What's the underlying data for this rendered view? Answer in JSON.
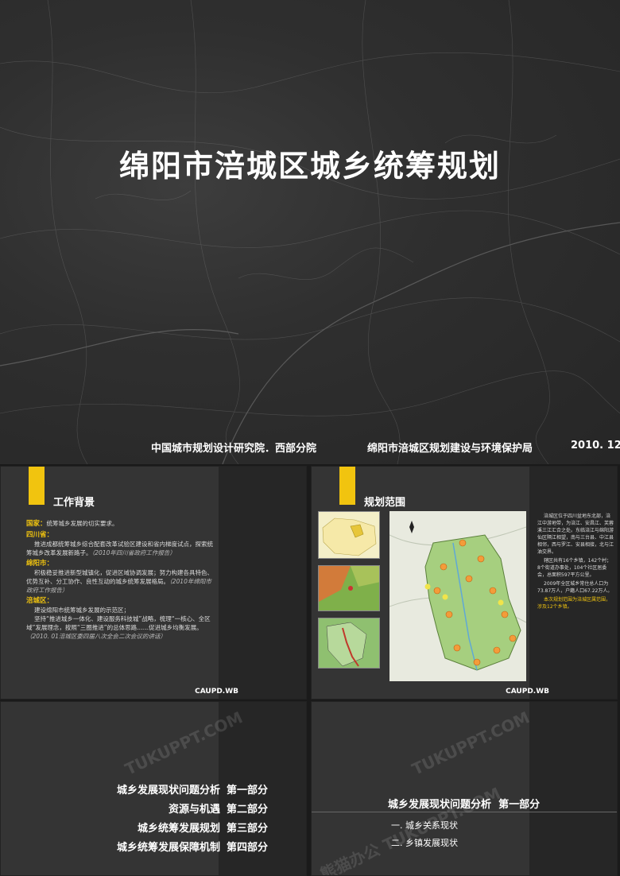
{
  "cover": {
    "title": "绵阳市涪城区城乡统筹规划",
    "org1": "中国城市规划设计研究院．西部分院",
    "org2": "绵阳市涪城区规划建设与环境保护局",
    "date": "2010. 12"
  },
  "slide1": {
    "title": "工作背景",
    "national_head": "国家：",
    "national_text": "统筹城乡发展的切实要求。",
    "sichuan_head": "四川省：",
    "sichuan_text": "推进成都统筹城乡综合配套改革试验区建设和省内梯度试点，探索统筹城乡改革发展新路子。",
    "sichuan_note": "（2010年四川省政府工作报告）",
    "mianyang_head": "绵阳市：",
    "mianyang_text": "积极稳妥推进新型城镇化，促进区域协调发展；努力构建各具特色、优势互补、分工协作、良性互动的城乡统筹发展格局。",
    "mianyang_note": "（2010年绵阳市政府工作报告）",
    "fucheng_head": "涪城区：",
    "fucheng_text1": "建设绵阳市统筹城乡发展的示范区；",
    "fucheng_text2": "坚持“推进城乡一体化、建设服务科技城”战略，梳理“一核心、全区域”发展理念，按照“三圈推进”的总体思路……促进城乡均衡发展。",
    "fucheng_note": "（2010. 01涪城区委四届八次全会二次会议的讲话）",
    "footer": "CAUPD.WB"
  },
  "slide2": {
    "title": "规划范围",
    "p1": "涪城区位于四川盆地东北部，涪江中游地带，为涪江、安昌江、芙蓉溪三江汇合之处。东临涪江与绵阳游仙区隔江相望，南与三台县、中江县相邻，西与罗江、安县相接，北与江油交界。",
    "p2": "辖区共有16个乡镇，142个村；8个街道办事处，104个社区居委会，总面积597平方公里。",
    "p3": "2009年全区城乡常住总人口为73.87万人，户籍人口67.22万人。",
    "p4": "本次规划范围为涪城区属范围，涉及12个乡镇。",
    "footer": "CAUPD.WB"
  },
  "slide3": {
    "items": [
      {
        "label": "城乡发展现状问题分析",
        "part": "第一部分"
      },
      {
        "label": "资源与机遇",
        "part": "第二部分"
      },
      {
        "label": "城乡统筹发展规划",
        "part": "第三部分"
      },
      {
        "label": "城乡统筹发展保障机制",
        "part": "第四部分"
      }
    ]
  },
  "slide4": {
    "title": "城乡发展现状问题分析",
    "part": "第一部分",
    "item1": "一. 城乡关系现状",
    "item2": "二. 乡镇发展现状"
  },
  "watermarks": {
    "text1": "熊猫办公 TUKUPPT.COM",
    "text2": "TUKUPPT.COM"
  },
  "colors": {
    "accent": "#f1c40f",
    "bg": "#343434",
    "dark": "#262626"
  }
}
